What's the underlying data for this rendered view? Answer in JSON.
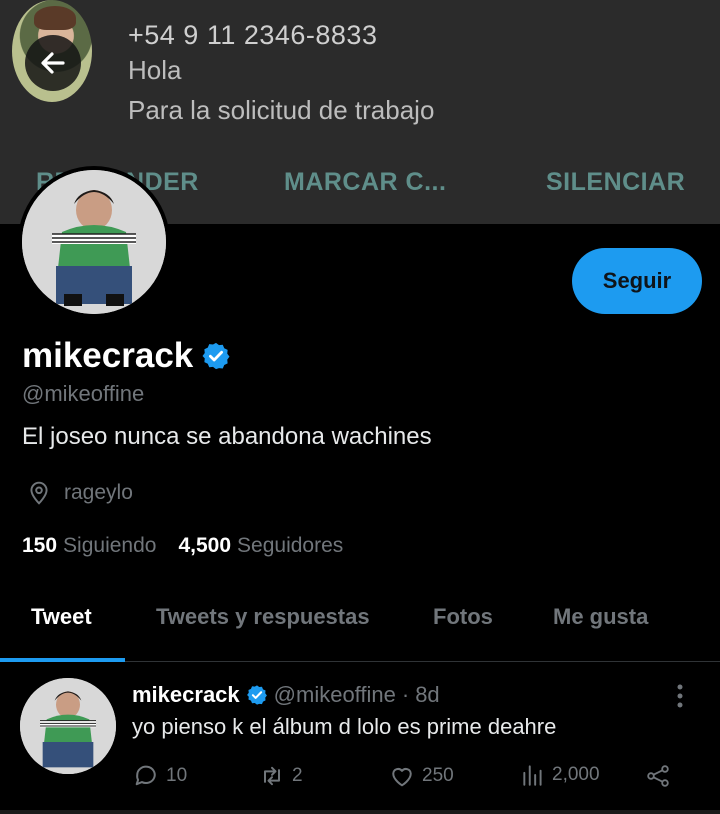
{
  "notification": {
    "number": "+54 9 11 2346-8833",
    "line1": "Hola",
    "line2": "Para la solicitud de trabajo",
    "actions": [
      "RESPONDER",
      "MARCAR C...",
      "SILENCIAR"
    ]
  },
  "profile": {
    "name": "mikecrack",
    "handle": "@mikeoffine",
    "bio": "El joseo nunca se abandona wachines",
    "location": "rageylo",
    "following_count": "150",
    "following_label": "Siguiendo",
    "followers_count": "4,500",
    "followers_label": "Seguidores",
    "follow_button": "Seguir"
  },
  "tabs": [
    "Tweet",
    "Tweets y respuestas",
    "Fotos",
    "Me gusta"
  ],
  "tweet": {
    "name": "mikecrack",
    "handle": "@mikeoffine",
    "dot": "·",
    "time": "8d",
    "text": "yo pienso k el álbum d lolo es prime deahre",
    "replies": "10",
    "retweets": "2",
    "likes": "250",
    "views": "2,000"
  },
  "colors": {
    "accent": "#1d9bf0",
    "muted": "#71767b",
    "notif_action": "#5f8e8a"
  },
  "icons": [
    "back-arrow-icon",
    "verified-badge-icon",
    "location-pin-icon",
    "more-vertical-icon",
    "reply-icon",
    "retweet-icon",
    "like-icon",
    "views-icon",
    "share-icon"
  ]
}
